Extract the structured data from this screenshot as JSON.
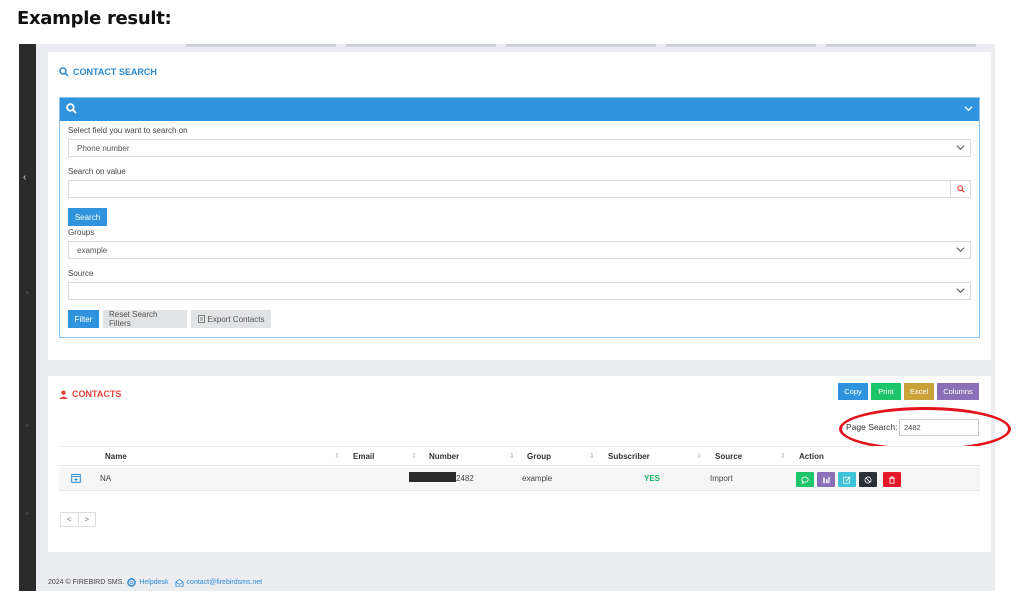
{
  "heading": "Example result:",
  "contact_search": {
    "title": "CONTACT SEARCH",
    "field_label": "Select field you want to search on",
    "field_value": "Phone number",
    "value_label": "Search on value",
    "value_input": "",
    "search_button": "Search",
    "groups_label": "Groups",
    "groups_value": "example",
    "source_label": "Source",
    "source_value": "",
    "filter_button": "Filter",
    "reset_button": "Reset Search Filters",
    "export_button": "Export Contacts"
  },
  "contacts": {
    "title": "CONTACTS",
    "export_buttons": [
      "Copy",
      "Print",
      "Excel",
      "Columns"
    ],
    "page_search_label": "Page Search:",
    "page_search_value": "2482",
    "columns": [
      "Name",
      "Email",
      "Number",
      "Group",
      "Subscriber",
      "Source",
      "Action"
    ],
    "row": {
      "name": "NA",
      "email": "",
      "number": "2482",
      "group": "example",
      "subscriber": "YES",
      "source": "Import"
    },
    "pager": [
      "<",
      ">"
    ]
  },
  "footer": {
    "text": "2024 © FIREBIRD SMS.",
    "helpdesk": "Helpdesk",
    "email": "contact@firebirdsms.net"
  },
  "colors": {
    "primary": "#2f94dd",
    "copy": "#2f94dd",
    "print": "#1ec46a",
    "excel": "#c9a33a",
    "columns": "#8b6fb8",
    "danger": "#e3453a",
    "highlight": "#e2141c"
  }
}
